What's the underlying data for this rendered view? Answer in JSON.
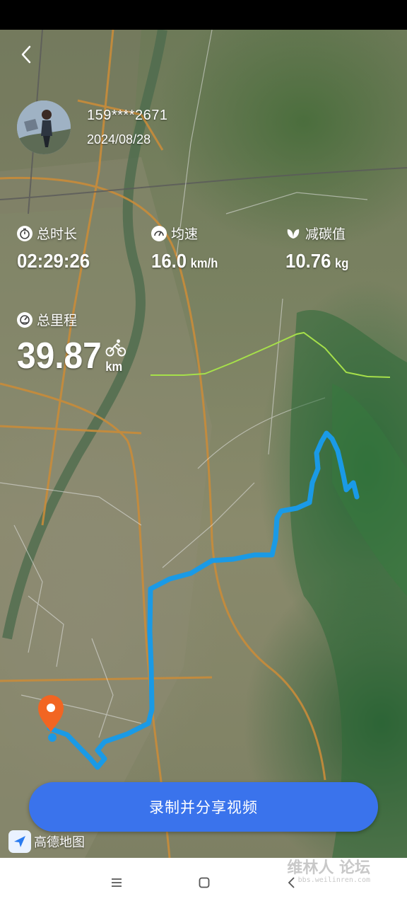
{
  "user": {
    "phone": "159****2671",
    "date": "2024/08/28"
  },
  "stats": {
    "total_time": {
      "label": "总时长",
      "value": "02:29:26",
      "icon": "stopwatch-icon"
    },
    "avg_speed": {
      "label": "均速",
      "value": "16.0",
      "unit": "km/h",
      "icon": "speedometer-icon"
    },
    "carbon": {
      "label": "减碳值",
      "value": "10.76",
      "unit": "kg",
      "icon": "leaf-icon"
    },
    "distance": {
      "label": "总里程",
      "value": "39.87",
      "unit": "km",
      "icon": "odometer-icon",
      "activity_icon": "cycling-icon"
    }
  },
  "share_button": {
    "label": "录制并分享视频"
  },
  "map": {
    "provider_logo": "高德地图",
    "route_color": "#1a9ae6",
    "elevation_color": "#a6e04a",
    "start_marker_color": "#f26522"
  },
  "watermark": {
    "title": "维林人 论坛",
    "subtitle": "bbs.weilinren.com"
  },
  "colors": {
    "accent": "#3a73ec"
  }
}
